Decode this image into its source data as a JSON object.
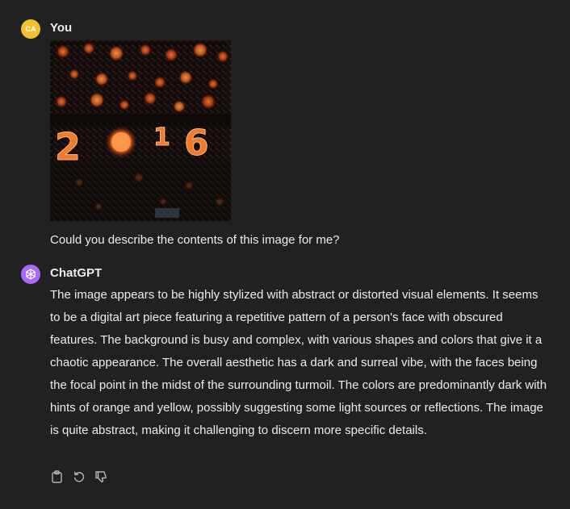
{
  "user": {
    "avatar_initials": "CA",
    "name": "You",
    "image_alt": "2016",
    "message": "Could you describe the contents of this image for me?"
  },
  "assistant": {
    "name": "ChatGPT",
    "icon": "openai-logo-icon",
    "message": "The image appears to be highly stylized with abstract or distorted visual elements. It seems to be a digital art piece featuring a repetitive pattern of a person's face with obscured features. The background is busy and complex, with various shapes and colors that give it a chaotic appearance. The overall aesthetic has a dark and surreal vibe, with the faces being the focal point in the midst of the surrounding turmoil. The colors are predominantly dark with hints of orange and yellow, possibly suggesting some light sources or reflections. The image is quite abstract, making it challenging to discern more specific details."
  },
  "actions": [
    {
      "name": "copy",
      "icon": "clipboard-icon"
    },
    {
      "name": "regenerate",
      "icon": "regenerate-icon"
    },
    {
      "name": "bad-response",
      "icon": "thumbs-down-icon"
    }
  ],
  "colors": {
    "background": "#212121",
    "text": "#ececec",
    "user_avatar": "#f2c12e",
    "assistant_avatar": "#ab68ff",
    "icon": "#b4b4b4"
  }
}
